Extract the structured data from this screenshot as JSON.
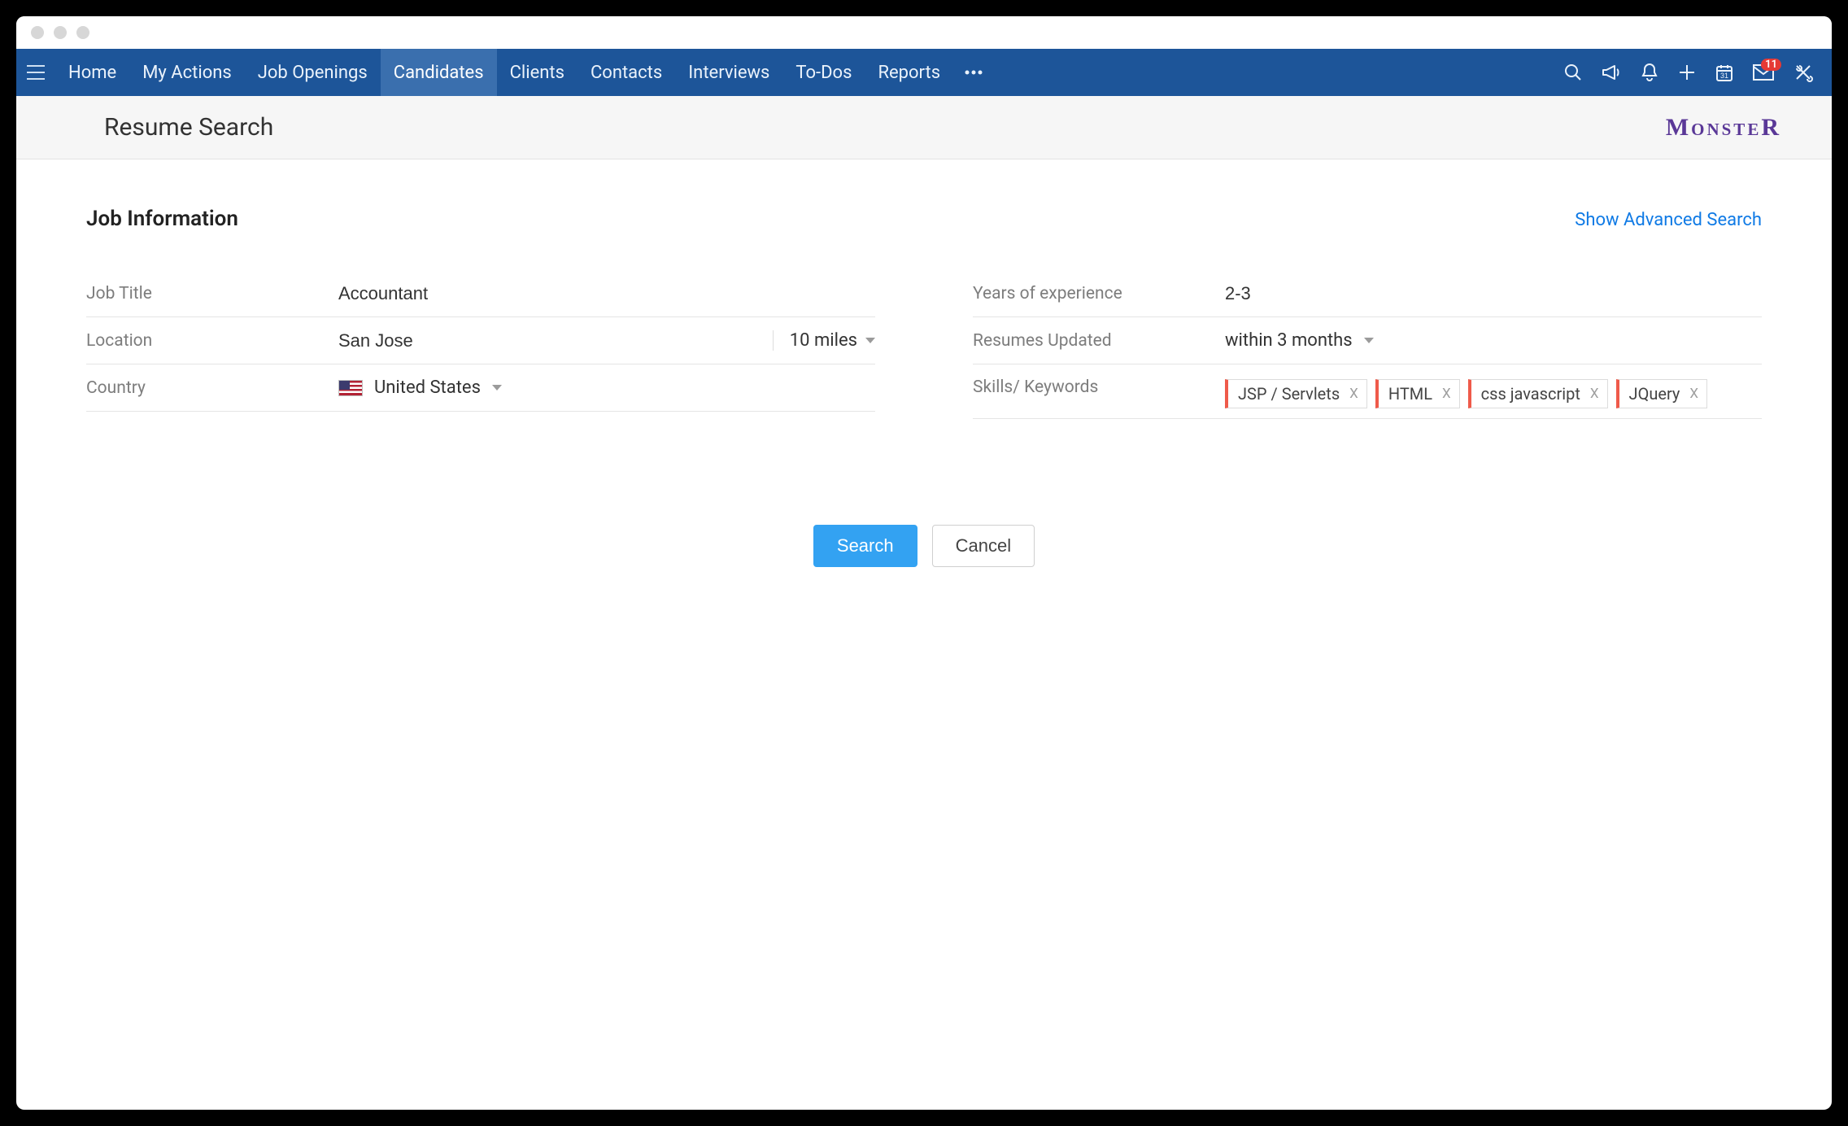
{
  "nav": {
    "items": [
      "Home",
      "My Actions",
      "Job Openings",
      "Candidates",
      "Clients",
      "Contacts",
      "Interviews",
      "To-Dos",
      "Reports"
    ],
    "active_index": 3,
    "mail_badge": "11"
  },
  "subheader": {
    "title": "Resume Search",
    "brand": "MonsteR"
  },
  "section": {
    "heading": "Job Information",
    "advanced_link": "Show Advanced Search"
  },
  "form": {
    "labels": {
      "job_title": "Job Title",
      "location": "Location",
      "country": "Country",
      "years_experience": "Years of experience",
      "resumes_updated": "Resumes Updated",
      "skills": "Skills/ Keywords"
    },
    "job_title": "Accountant",
    "location": "San Jose",
    "radius": "10 miles",
    "country": "United States",
    "years_experience": "2-3",
    "resumes_updated": "within 3 months",
    "skills": [
      "JSP / Servlets",
      "HTML",
      "css javascript",
      "JQuery"
    ]
  },
  "buttons": {
    "search": "Search",
    "cancel": "Cancel"
  }
}
